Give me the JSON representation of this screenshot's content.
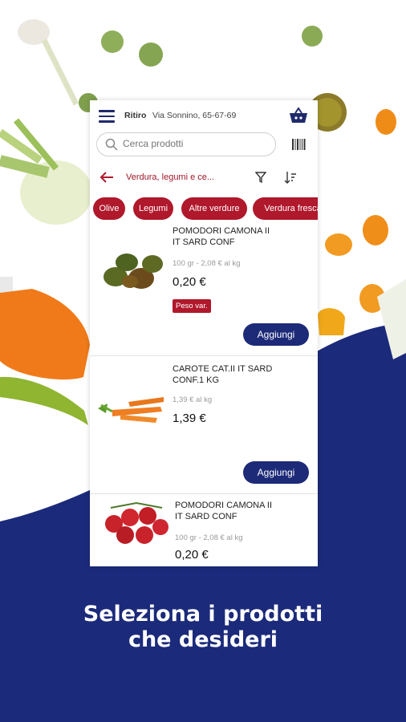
{
  "caption": {
    "line1": "Seleziona i prodotti",
    "line2": "che desideri"
  },
  "header": {
    "mode_label": "Ritiro",
    "address": "Via Sonnino, 65-67-69",
    "icons": [
      "menu-icon",
      "basket-icon"
    ]
  },
  "search": {
    "placeholder": "Cerca prodotti",
    "icons": [
      "search-icon",
      "barcode-icon"
    ]
  },
  "breadcrumb": {
    "text": "Verdura, legumi e ce...",
    "icons": [
      "back-arrow-icon",
      "filter-icon",
      "sort-icon"
    ]
  },
  "chips": [
    "Olive",
    "Legumi",
    "Altre verdure",
    "Verdura fresca"
  ],
  "products": [
    {
      "name_line1": "POMODORI CAMONA II",
      "name_line2": "IT SARD CONF",
      "unit_price": "100 gr - 2,08 € al kg",
      "price": "0,20 €",
      "badge": "Peso var.",
      "button": "Aggiungi"
    },
    {
      "name_line1": "CAROTE CAT.II IT SARD",
      "name_line2": "CONF.1 KG",
      "unit_price": "1,39 € al kg",
      "price": "1,39 €",
      "button": "Aggiungi"
    },
    {
      "name_line1": "POMODORI CAMONA II",
      "name_line2": "IT SARD CONF",
      "unit_price": "100 gr - 2,08 € al kg",
      "price": "0,20 €"
    }
  ],
  "colors": {
    "brand_blue": "#1d2a78",
    "accent_red": "#b0182c"
  }
}
